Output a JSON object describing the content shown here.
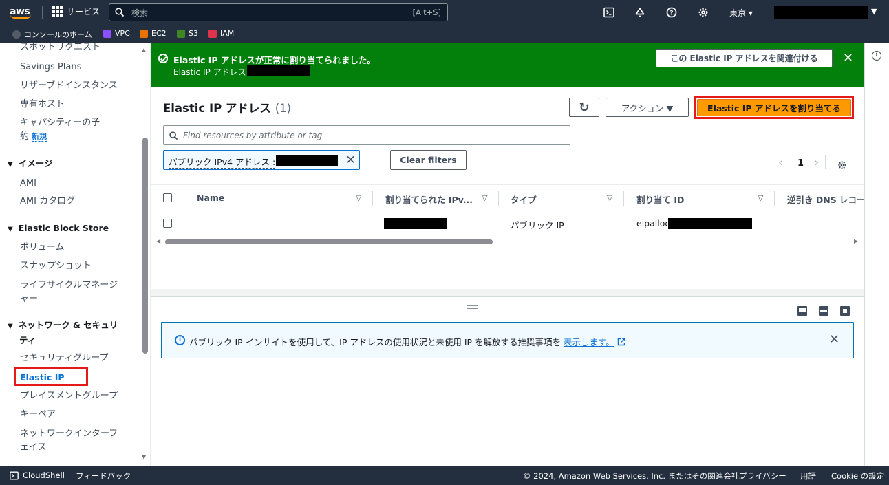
{
  "topnav": {
    "logo_text": "aws",
    "services_label": "サービス",
    "search_placeholder": "検索",
    "search_shortcut": "[Alt+S]",
    "region_label": "東京 ▾",
    "icons": [
      "cloudshell-icon",
      "bell-icon",
      "help-icon",
      "gear-icon"
    ]
  },
  "favorites": [
    {
      "label": "コンソールのホーム",
      "color": "#545b64"
    },
    {
      "label": "VPC",
      "color": "#8c4fff"
    },
    {
      "label": "EC2",
      "color": "#ed7100"
    },
    {
      "label": "S3",
      "color": "#3f8624"
    },
    {
      "label": "IAM",
      "color": "#dd344c"
    }
  ],
  "sidebar": {
    "items": {
      "spot": "スポットリクエスト",
      "savings": "Savings Plans",
      "reserved": "リザーブドインスタンス",
      "dedicated": "専有ホスト",
      "capacity_1": "キャパシティーの予",
      "capacity_2": "約",
      "capacity_badge": "新規",
      "images_section": "イメージ",
      "ami": "AMI",
      "ami_catalog": "AMI カタログ",
      "ebs_section": "Elastic Block Store",
      "volumes": "ボリューム",
      "snapshots": "スナップショット",
      "lifecycle_1": "ライフサイクルマネージ",
      "lifecycle_2": "ャー",
      "network_section_1": "ネットワーク & セキュリ",
      "network_section_2": "ティ",
      "security_groups": "セキュリティグループ",
      "elastic_ip": "Elastic IP",
      "placement": "プレイスメントグループ",
      "keypairs": "キーペア",
      "eni_1": "ネットワークインターフ",
      "eni_2": "ェイス"
    }
  },
  "flash": {
    "title": "Elastic IP アドレスが正常に割り当てられました。",
    "subtitle": "Elastic IP アドレス",
    "associate_button": "この Elastic IP アドレスを関連付ける",
    "close": "✕",
    "background": "#037f0c"
  },
  "panel": {
    "title": "Elastic IP アドレス",
    "count": "(1)",
    "refresh_icon": "↻",
    "actions_label": "アクション ▼",
    "allocate_label": "Elastic IP アドレスを割り当てる",
    "filter_placeholder": "Find resources by attribute or tag",
    "token_label": "パブリック IPv4 アドレス :",
    "token_close": "✕",
    "clear_filters": "Clear filters",
    "page_prev": "‹",
    "page_number": "1",
    "page_next": "›"
  },
  "table": {
    "headers": [
      "Name",
      "割り当てられた IPv...",
      "タイプ",
      "割り当て ID",
      "逆引き DNS レコー"
    ],
    "rows": [
      {
        "name": "–",
        "ip": "",
        "type": "パブリック IP",
        "alloc_id_prefix": "eipalloc",
        "reverse_dns": "–"
      }
    ]
  },
  "split": {
    "info_text": "パブリック IP インサイトを使用して、IP アドレスの使用状況と未使用 IP を解放する推奨事項を",
    "info_link": "表示します。",
    "info_icon": "i",
    "close": "✕"
  },
  "rail": {
    "info_icon": "i"
  },
  "footer": {
    "cloudshell": "CloudShell",
    "feedback": "フィードバック",
    "copyright": "© 2024, Amazon Web Services, Inc. またはその関連会社。",
    "privacy": "プライバシー",
    "terms": "用語",
    "cookie": "Cookie の設定"
  },
  "colors": {
    "accent": "#ff9900",
    "nav": "#232f3e",
    "link": "#0972d3",
    "highlight": "#e41a1a"
  }
}
